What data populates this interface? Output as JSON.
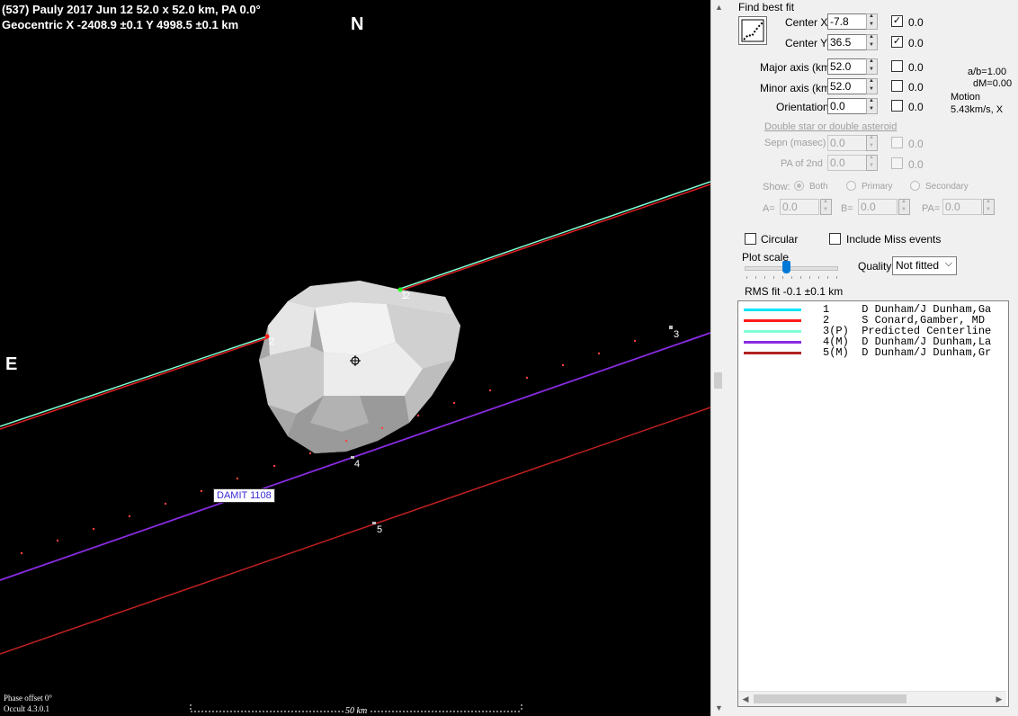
{
  "plot": {
    "header_line1": "(537) Pauly  2017 Jun 12  52.0 x 52.0 km, PA 0.0°",
    "header_line2": "Geocentric  X  -2408.9 ±0.1  Y 4998.5 ±0.1 km",
    "north_label": "N",
    "east_label": "E",
    "model_label": "DAMIT 1108",
    "chord_labels": [
      "1",
      "2",
      "2",
      "3",
      "4",
      "5"
    ],
    "phase_offset": "Phase offset 0°",
    "version": "Occult 4.3.0.1",
    "scale_label": "50 km",
    "colors": {
      "chord1": "#00e5ff",
      "chord2": "#ff2020",
      "chord3": "#7fffd4",
      "chord4": "#8a2be2",
      "chord5": "#c02020",
      "predicted_dots": "#ff4040"
    }
  },
  "panel": {
    "find_best_fit": "Find best fit",
    "center_x_label": "Center X",
    "center_x_value": "-7.8",
    "center_x_step": "0.0",
    "center_y_label": "Center Y",
    "center_y_value": "36.5",
    "center_y_step": "0.0",
    "major_label": "Major axis (km)",
    "major_value": "52.0",
    "major_step": "0.0",
    "minor_label": "Minor axis (km)",
    "minor_value": "52.0",
    "minor_step": "0.0",
    "orient_label": "Orientation",
    "orient_value": "0.0",
    "orient_step": "0.0",
    "ab_ratio": "a/b=1.00",
    "dm": "dM=0.00",
    "motion_label": "Motion",
    "motion_value": "5.43km/s, X",
    "double_star_link": "Double star  or  double asteroid",
    "sepn_label": "Sepn (masec)",
    "sepn_value": "0.0",
    "sepn_step": "0.0",
    "pa2_label": "PA of 2nd",
    "pa2_value": "0.0",
    "pa2_step": "0.0",
    "show_label": "Show:",
    "show_options": [
      "Both",
      "Primary",
      "Secondary"
    ],
    "a_label": "A=",
    "a_value": "0.0",
    "b_label": "B=",
    "b_value": "0.0",
    "pa_label": "PA=",
    "pa_value": "0.0",
    "circular_label": "Circular",
    "include_miss_label": "Include Miss events",
    "plot_scale_label": "Plot scale",
    "quality_label": "Quality",
    "quality_value": "Not fitted",
    "rms_fit": "RMS fit  -0.1 ±0.1 km",
    "legend": [
      {
        "num": "1   ",
        "text": "D Dunham/J Dunham,Ga",
        "color": "#00e5ff"
      },
      {
        "num": "2   ",
        "text": "S Conard,Gamber, MD",
        "color": "#ff1a1a"
      },
      {
        "num": "3(P)",
        "text": "Predicted Centerline",
        "color": "#7fffd4"
      },
      {
        "num": "4(M)",
        "text": "D Dunham/J Dunham,La",
        "color": "#8a2be2"
      },
      {
        "num": "5(M)",
        "text": "D Dunham/J Dunham,Gr",
        "color": "#b22222"
      }
    ]
  }
}
